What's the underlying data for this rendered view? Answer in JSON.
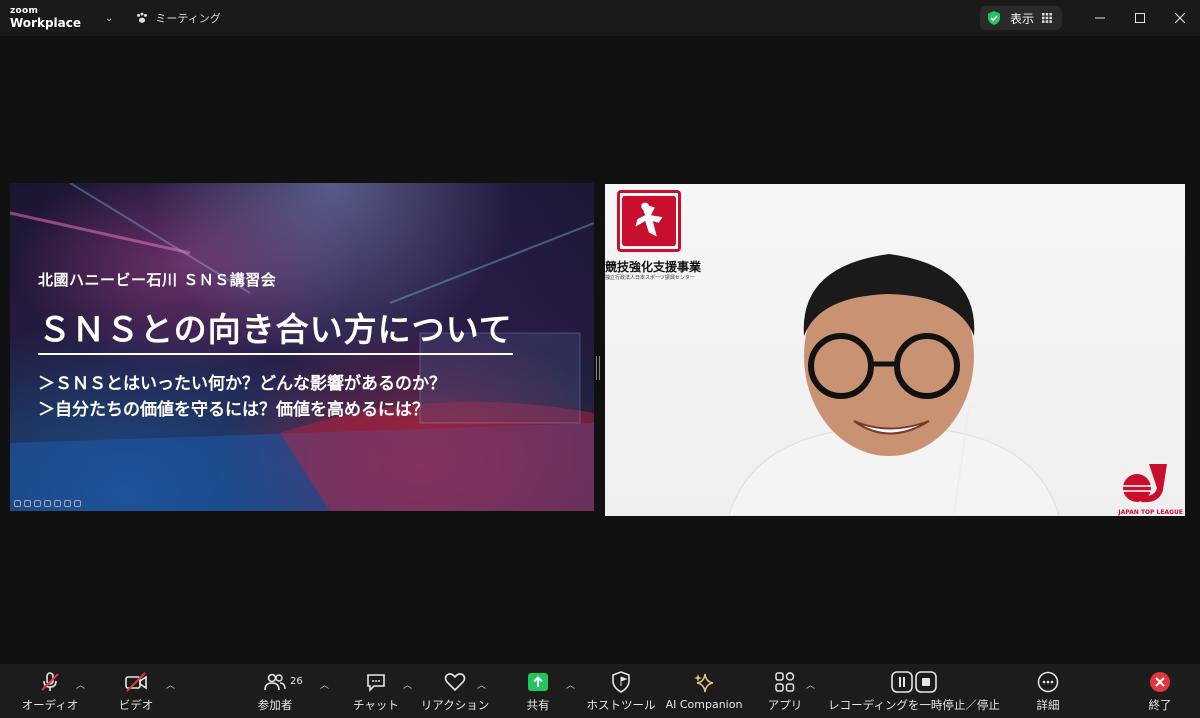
{
  "titlebar": {
    "brand_small": "zoom",
    "brand_main": "Workplace",
    "meeting_label": "ミーティング",
    "view_label": "表示"
  },
  "slide": {
    "subtitle": "北國ハニービー石川 ＳＮＳ講習会",
    "title": "ＳＮＳとの向き合い方について",
    "bullet1": "＞ＳＮＳとはいったい何か？どんな影響があるのか？",
    "bullet2": "＞自分たちの価値を守るには？価値を高めるには？"
  },
  "camera": {
    "logo_text": "競技強化支援事業",
    "logo_sub": "独立行政法人日本スポーツ振興センター",
    "league_text": "JAPAN TOP LEAGUE"
  },
  "toolbar": {
    "audio": "オーディオ",
    "video": "ビデオ",
    "participants": "参加者",
    "participants_count": "26",
    "chat": "チャット",
    "reactions": "リアクション",
    "share": "共有",
    "host_tools": "ホストツール",
    "ai_companion": "AI Companion",
    "apps": "アプリ",
    "recording": "レコーディングを一時停止／停止",
    "more": "詳細",
    "end": "終了"
  },
  "colors": {
    "accent_green": "#22c55e",
    "end_red": "#e0383e",
    "muted_red": "#e0383e",
    "brand_red": "#c8102e"
  }
}
